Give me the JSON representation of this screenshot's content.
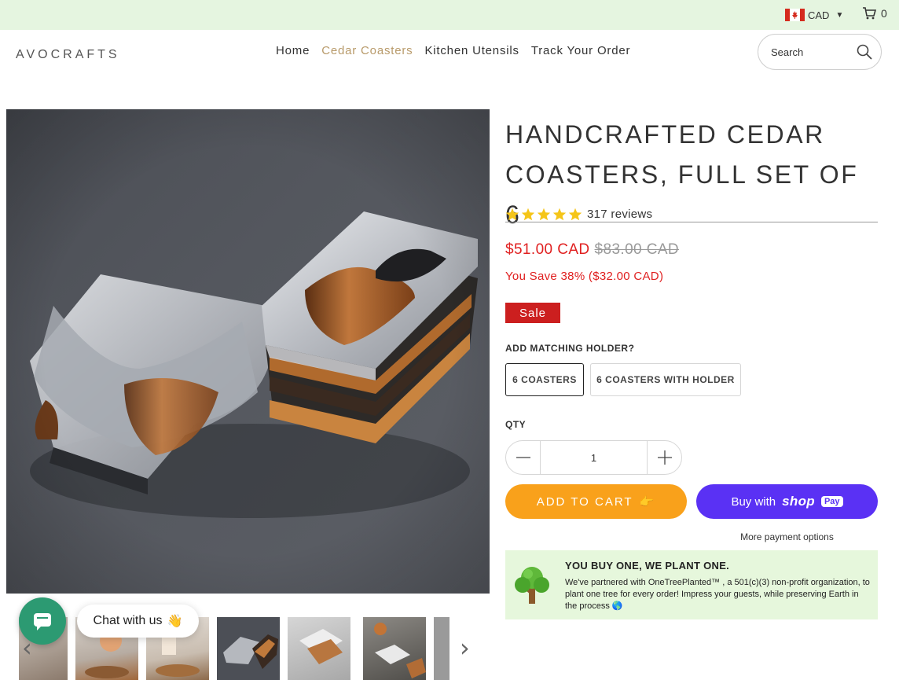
{
  "topbar": {
    "currency": "CAD",
    "cart_count": "0"
  },
  "header": {
    "logo": "AVOCRAFTS",
    "nav": [
      {
        "label": "Home"
      },
      {
        "label": "Cedar Coasters",
        "active": true
      },
      {
        "label": "Kitchen Utensils"
      },
      {
        "label": "Track Your Order"
      }
    ],
    "search_placeholder": "Search"
  },
  "product": {
    "title": "HANDCRAFTED CEDAR COASTERS, FULL SET OF 6",
    "review_count": "317 reviews",
    "rating_stars": 5,
    "price_now": "$51.00 CAD",
    "price_was": "$83.00 CAD",
    "savings": "You Save 38% ($32.00 CAD)",
    "badge": "Sale",
    "option_label": "ADD MATCHING HOLDER?",
    "options": [
      "6 COASTERS",
      "6 COASTERS WITH HOLDER"
    ],
    "selected_option": "6 COASTERS",
    "qty_label": "QTY",
    "qty_value": "1",
    "add_to_cart": "ADD TO CART",
    "add_to_cart_emoji": "👉",
    "buy_with": "Buy with",
    "shop_pay_word": "shop",
    "shop_pay_pill": "Pay",
    "more_payment": "More payment options"
  },
  "tree_banner": {
    "heading": "YOU BUY ONE, WE PLANT ONE.",
    "body": "We've partnered with OneTreePlanted™ , a 501(c)(3) non-profit organization, to plant one tree for every order! Impress your guests, while preserving Earth in the process 🌎"
  },
  "chat": {
    "label": "Chat with us",
    "emoji": "👋"
  },
  "colors": {
    "topbar": "#e5f5e0",
    "accent_nav": "#b89a6a",
    "sale_red": "#e02020",
    "badge_red": "#cc1f1f",
    "add_to_cart": "#f9a11b",
    "shop_pay": "#5a31f4",
    "chat_green": "#2c9a72",
    "star_yellow": "#f5c518"
  }
}
